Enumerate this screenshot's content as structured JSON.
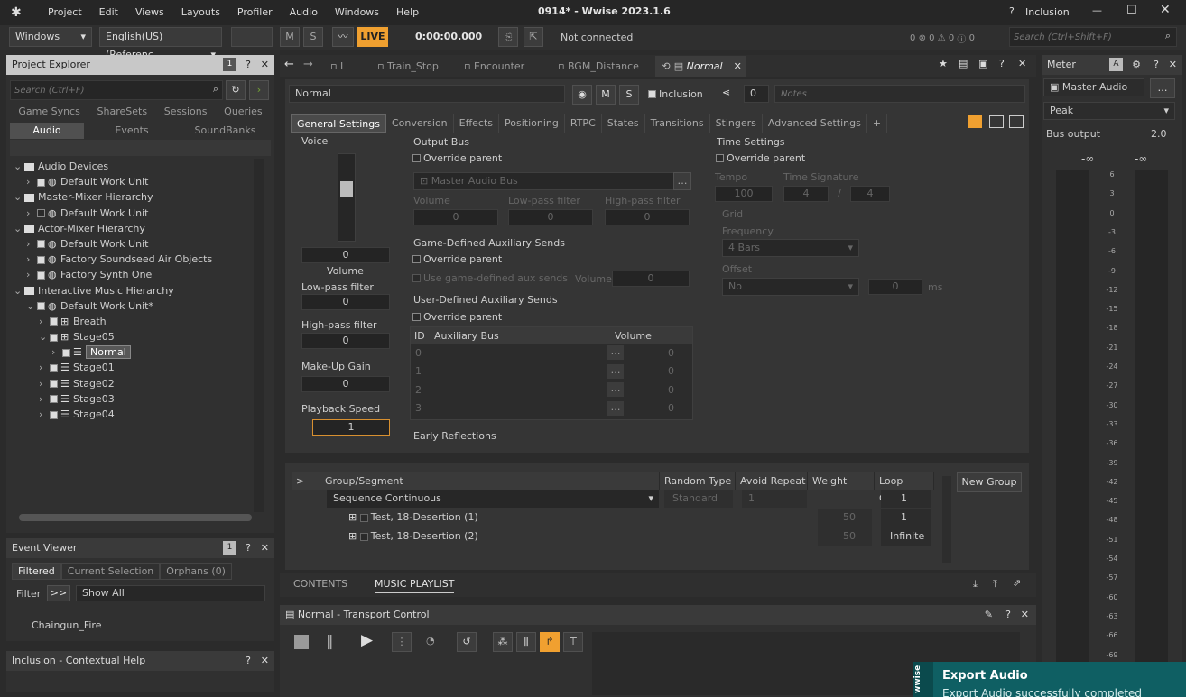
{
  "app": {
    "title": "0914* - Wwise 2023.1.6",
    "inclusion": "Inclusion"
  },
  "menu": [
    "Project",
    "Edit",
    "Views",
    "Layouts",
    "Profiler",
    "Audio",
    "Windows",
    "Help"
  ],
  "toolbar": {
    "platform": "Windows",
    "language": "English(US) (Referenc...",
    "m": "M",
    "s": "S",
    "live": "LIVE",
    "time": "0:00:00.000",
    "connection": "Not connected",
    "err_counts": [
      "0",
      "0",
      "0",
      "0"
    ],
    "search_placeholder": "Search (Ctrl+Shift+F)"
  },
  "project_explorer": {
    "title": "Project Explorer",
    "badge": "1",
    "search_placeholder": "Search (Ctrl+F)",
    "tabs_row1": [
      "Game Syncs",
      "ShareSets",
      "Sessions",
      "Queries"
    ],
    "tabs_row2": [
      "Audio",
      "Events",
      "SoundBanks"
    ],
    "tree": [
      {
        "label": "Audio Devices",
        "level": 0,
        "open": true,
        "type": "folder"
      },
      {
        "label": "Default Work Unit",
        "level": 1,
        "type": "wu",
        "chk": true
      },
      {
        "label": "Master-Mixer Hierarchy",
        "level": 0,
        "open": true,
        "type": "folder"
      },
      {
        "label": "Default Work Unit",
        "level": 1,
        "type": "wu",
        "chk": false
      },
      {
        "label": "Actor-Mixer Hierarchy",
        "level": 0,
        "open": true,
        "type": "folder"
      },
      {
        "label": "Default Work Unit",
        "level": 1,
        "type": "wu",
        "chk": true
      },
      {
        "label": "Factory Soundseed Air Objects",
        "level": 1,
        "type": "wu",
        "chk": true
      },
      {
        "label": "Factory Synth One",
        "level": 1,
        "type": "wu",
        "chk": true
      },
      {
        "label": "Interactive Music Hierarchy",
        "level": 0,
        "open": true,
        "type": "folder"
      },
      {
        "label": "Default Work Unit*",
        "level": 1,
        "type": "wu",
        "chk": true,
        "open": true
      },
      {
        "label": "Breath",
        "level": 2,
        "type": "switch",
        "chk": true
      },
      {
        "label": "Stage05",
        "level": 2,
        "type": "switch",
        "chk": true,
        "open": true
      },
      {
        "label": "Normal",
        "level": 3,
        "type": "playlist",
        "chk": true,
        "selected": true
      },
      {
        "label": "Stage01",
        "level": 2,
        "type": "playlist",
        "chk": true
      },
      {
        "label": "Stage02",
        "level": 2,
        "type": "playlist",
        "chk": true
      },
      {
        "label": "Stage03",
        "level": 2,
        "type": "playlist",
        "chk": true
      },
      {
        "label": "Stage04",
        "level": 2,
        "type": "playlist",
        "chk": true
      }
    ]
  },
  "event_viewer": {
    "title": "Event Viewer",
    "badge": "1",
    "tabs": [
      "Filtered",
      "Current Selection",
      "Orphans (0)"
    ],
    "filter_label": "Filter",
    ">>": ">>",
    "show_all": "Show All",
    "items": [
      "Chaingun_Fire"
    ]
  },
  "contextual_help": {
    "title": "Inclusion - Contextual Help"
  },
  "editor_tabs": [
    "L",
    "Train_Stop",
    "Encounter",
    "BGM_Distance",
    "Normal"
  ],
  "object": {
    "name": "Normal",
    "m": "M",
    "s": "S",
    "inclusion": "Inclusion",
    "count": "0",
    "notes_placeholder": "Notes"
  },
  "prop_tabs": [
    "General Settings",
    "Conversion",
    "Effects",
    "Positioning",
    "RTPC",
    "States",
    "Transitions",
    "Stingers",
    "Advanced Settings",
    "+"
  ],
  "voice": {
    "title": "Voice",
    "volume_value": "0",
    "volume_label": "Volume",
    "lpf_label": "Low-pass filter",
    "lpf_value": "0",
    "hpf_label": "High-pass filter",
    "hpf_value": "0",
    "makeup_label": "Make-Up Gain",
    "makeup_value": "0",
    "speed_label": "Playback Speed",
    "speed_value": "1"
  },
  "output_bus": {
    "title": "Output Bus",
    "override": "Override parent",
    "bus": "Master Audio Bus",
    "volume": "Volume",
    "lpf": "Low-pass filter",
    "hpf": "High-pass filter",
    "v0": "0",
    "v1": "0",
    "v2": "0"
  },
  "game_aux": {
    "title": "Game-Defined Auxiliary Sends",
    "override": "Override parent",
    "use": "Use game-defined aux sends",
    "volume": "Volume",
    "value": "0"
  },
  "user_aux": {
    "title": "User-Defined Auxiliary Sends",
    "override": "Override parent",
    "cols": [
      "ID",
      "Auxiliary Bus",
      "Volume"
    ],
    "rows": [
      "0",
      "1",
      "2",
      "3"
    ],
    "values": [
      "0",
      "0",
      "0",
      "0"
    ]
  },
  "early_reflections": "Early Reflections",
  "time_settings": {
    "title": "Time Settings",
    "override": "Override parent",
    "tempo": "Tempo",
    "tempo_value": "100",
    "time_sig": "Time Signature",
    "sig_a": "4",
    "slash": "/",
    "sig_b": "4",
    "grid": "Grid",
    "frequency": "Frequency",
    "freq_value": "4 Bars",
    "offset": "Offset",
    "offset_value": "No",
    "offset_num": "0",
    "ms": "ms"
  },
  "playlist": {
    "cols": [
      ">",
      "Group/Segment",
      "Random Type",
      "Avoid Repeat",
      "Weight",
      "Loop Count"
    ],
    "new_group": "New Group",
    "group": {
      "label": "Sequence Continuous",
      "random": "Standard",
      "avoid": "1",
      "loop": "1"
    },
    "segments": [
      {
        "label": "Test, 18-Desertion (1)",
        "weight": "50",
        "loop": "1"
      },
      {
        "label": "Test, 18-Desertion (2)",
        "weight": "50",
        "loop": "Infinite"
      }
    ]
  },
  "bottom_tabs": [
    "CONTENTS",
    "MUSIC PLAYLIST"
  ],
  "transport": {
    "title": "Normal - Transport Control"
  },
  "meter": {
    "title": "Meter",
    "badge": "A",
    "target": "Master Audio ...",
    "mode": "Peak",
    "bus_output": "Bus output",
    "bus_value": "2.0",
    "inf_l": "-∞",
    "inf_r": "-∞",
    "scale": [
      "6",
      "3",
      "0",
      "-3",
      "-6",
      "-9",
      "-12",
      "-15",
      "-18",
      "-21",
      "-24",
      "-27",
      "-30",
      "-33",
      "-36",
      "-39",
      "-42",
      "-45",
      "-48",
      "-51",
      "-54",
      "-57",
      "-60",
      "-63",
      "-66",
      "-69"
    ]
  },
  "toast": {
    "title": "Export Audio",
    "message": "Export Audio successfully completed",
    "brand": "wwise"
  }
}
